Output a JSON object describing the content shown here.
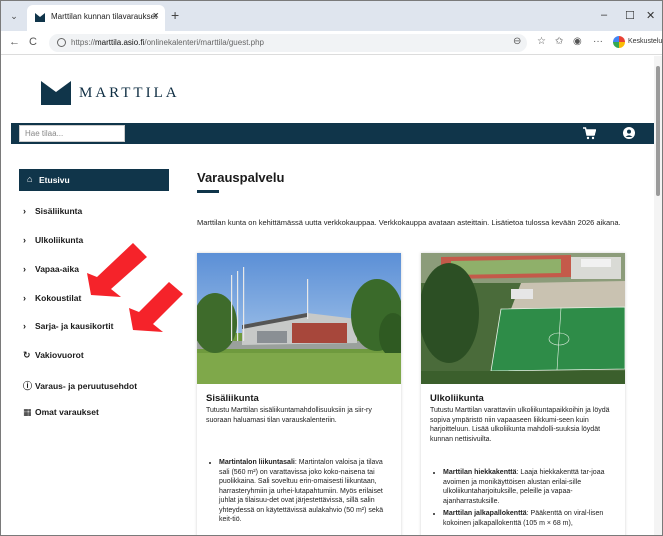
{
  "browser": {
    "tab_title": "Marttilan kunnan tilavaraukset",
    "url_prefix": "https://",
    "url_domain": "marttila.asio.fi",
    "url_path": "/onlinekalenteri/marttila/guest.php",
    "profile_label": "Keskustelu"
  },
  "site": {
    "logo_text": "MARTTILA",
    "brand_color": "#10354a",
    "search_placeholder": "Hae tilaa..."
  },
  "sidebar": {
    "items": [
      {
        "label": "Etusivu",
        "icon": "home-icon",
        "active": true
      },
      {
        "label": "Sisäliikunta",
        "icon": "chevron-right-icon"
      },
      {
        "label": "Ulkoliikunta",
        "icon": "chevron-right-icon"
      },
      {
        "label": "Vapaa-aika",
        "icon": "chevron-right-icon"
      },
      {
        "label": "Kokoustilat",
        "icon": "chevron-right-icon"
      },
      {
        "label": "Sarja- ja kausikortit",
        "icon": "chevron-right-icon"
      },
      {
        "label": "Vakiovuorot",
        "icon": "refresh-icon"
      },
      {
        "label": "Varaus- ja peruutusehdot",
        "icon": "info-icon"
      },
      {
        "label": "Omat varaukset",
        "icon": "calendar-icon"
      }
    ]
  },
  "main": {
    "title": "Varauspalvelu",
    "intro": "Marttilan kunta on kehittämässä uutta verkkokauppaa. Verkkokauppa avataan asteittain. Lisätietoa tulossa kevään 2026 aikana.",
    "cards": [
      {
        "title": "Sisäliikunta",
        "desc": "Tutustu Marttilan sisäliikuntamahdollisuuksiin ja siir-ry suoraan haluamasi tilan varauskalenteriin.",
        "items": [
          {
            "name": "Martintalon liikuntasali",
            "text": ": Martintalon valoisa ja tilava sali (560 m²) on varattavissa joko koko-naisena tai puolikkaina. Sali soveltuu erin-omaisesti liikuntaan, harrasteryhmiin ja urhei-lutapahtumiin. Myös erilaiset juhlat ja tilaisuu-det ovat järjestettävissä, sillä salin yhteydessä on käytettävissä aulakahvio (50 m²) sekä keit-tiö."
          }
        ]
      },
      {
        "title": "Ulkoliikunta",
        "desc": "Tutustu Marttilan varattaviin ulkoliikuntapaikkoihin ja löydä sopiva ympäristö niin vapaaseen liikkumi-seen kuin harjoitteluun. Lisää ulkoliikunta mahdolli-suuksia löydät kunnan nettisivuilta.",
        "items": [
          {
            "name": "Marttilan hiekkakenttä",
            "text": ": Laaja hiekkakenttä tar-joaa avoimen ja monikäyttöisen alustan erilai-sille ulkoliikuntaharjoituksille, peleille ja vapaa-ajanharrastuksille."
          },
          {
            "name": "Marttilan jalkapallokenttä",
            "text": ": Pääkenttä on viral-lisen kokoinen jalkapallokenttä (105 m × 68 m),"
          }
        ]
      }
    ]
  }
}
